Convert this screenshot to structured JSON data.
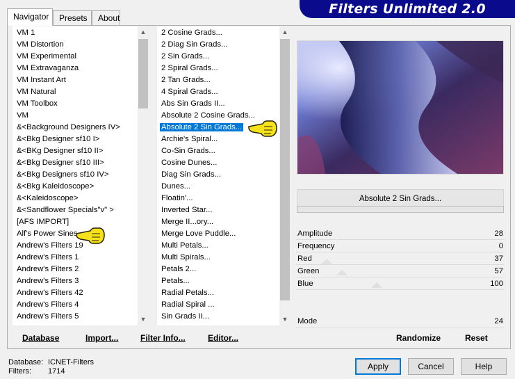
{
  "banner_title": "Filters Unlimited 2.0",
  "tabs": [
    {
      "label": "Navigator"
    },
    {
      "label": "Presets"
    },
    {
      "label": "About"
    }
  ],
  "categories": [
    "VM 1",
    "VM Distortion",
    "VM Experimental",
    "VM Extravaganza",
    "VM Instant Art",
    "VM Natural",
    "VM Toolbox",
    "VM",
    "&<Background Designers IV>",
    "&<Bkg Designer sf10 I>",
    "&<BKg Designer sf10 II>",
    "&<Bkg Designer sf10 III>",
    "&<Bkg Designers sf10 IV>",
    "&<Bkg Kaleidoscope>",
    "&<Kaleidoscope>",
    "&<Sandflower Specials\"v\" >",
    "[AFS IMPORT]",
    "Alf's Power Sines",
    "Andrew's Filters 19",
    "Andrew's Filters 1",
    "Andrew's Filters 2",
    "Andrew's Filters 3",
    "Andrew's Filters 42",
    "Andrew's Filters 4",
    "Andrew's Filters 5"
  ],
  "filters": [
    "2 Cosine Grads...",
    "2 Diag Sin Grads...",
    "2 Sin Grads...",
    "2 Spiral Grads...",
    "2 Tan Grads...",
    "4 Spiral Grads...",
    "Abs Sin Grads II...",
    "Absolute 2 Cosine Grads...",
    "Absolute 2 Sin Grads...",
    "Archie's Spiral...",
    "Co-Sin Grads...",
    "Cosine Dunes...",
    "Diag Sin Grads...",
    "Dunes...",
    "Floatin'...",
    "Inverted Star...",
    "Merge II...ory...",
    "Merge Love Puddle...",
    "Multi Petals...",
    "Multi Spirals...",
    "Petals 2...",
    "Petals...",
    "Radial Petals...",
    "Radial Spiral ...",
    "Sin Grads II..."
  ],
  "selected_filter_index": 8,
  "selected_filter_name": "Absolute 2 Sin Grads...",
  "params": [
    {
      "label": "Amplitude",
      "value": "28"
    },
    {
      "label": "Frequency",
      "value": "0"
    },
    {
      "label": "Red",
      "value": "37"
    },
    {
      "label": "Green",
      "value": "57"
    },
    {
      "label": "Blue",
      "value": "100"
    }
  ],
  "mode": {
    "label": "Mode",
    "value": "24"
  },
  "toolbar": {
    "database": "Database",
    "import": "Import...",
    "filter_info": "Filter Info...",
    "editor": "Editor...",
    "randomize": "Randomize",
    "reset": "Reset"
  },
  "status": {
    "database_label": "Database:",
    "database_value": "ICNET-Filters",
    "filters_label": "Filters:",
    "filters_value": "1714"
  },
  "buttons": {
    "apply": "Apply",
    "cancel": "Cancel",
    "help": "Help"
  },
  "colors": {
    "banner": "#0a0a8c",
    "selection": "#0078d7",
    "hand": "#f6e21a"
  }
}
